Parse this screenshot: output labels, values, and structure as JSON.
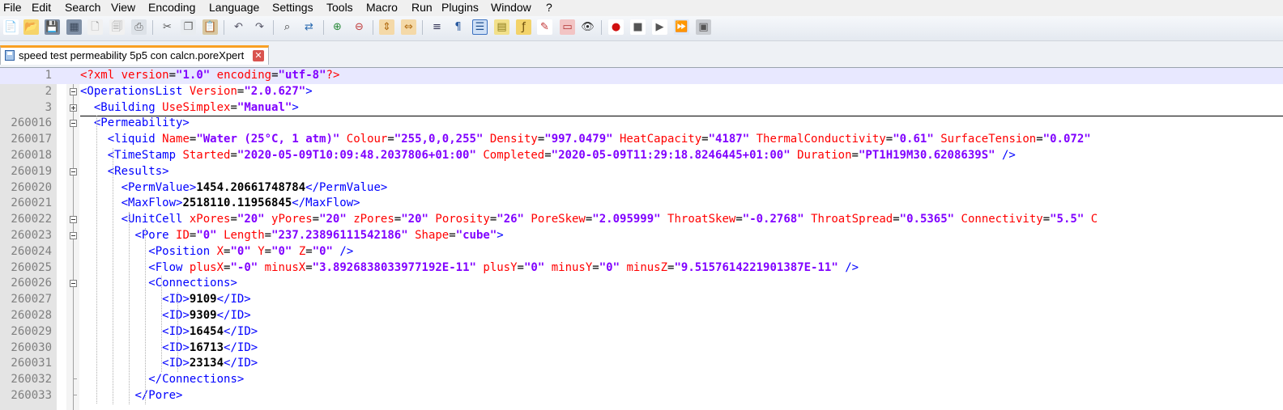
{
  "menu": [
    "File",
    "Edit",
    "Search",
    "View",
    "Encoding",
    "Language",
    "Settings",
    "Tools",
    "Macro",
    "Run",
    "Plugins",
    "Window",
    "?"
  ],
  "toolbar": {
    "icons": [
      "new-file-icon",
      "open-file-icon",
      "save-icon",
      "save-all-icon",
      "close-icon",
      "close-all-icon",
      "print-icon",
      "cut-icon",
      "copy-icon",
      "paste-icon",
      "undo-icon",
      "redo-icon",
      "find-icon",
      "replace-icon",
      "zoom-in-icon",
      "zoom-out-icon",
      "sync-vertical-icon",
      "sync-horizontal-icon",
      "word-wrap-icon",
      "show-all-characters-icon",
      "indent-guide-icon",
      "document-map-icon",
      "function-list-icon",
      "udl-icon",
      "folder-workspace-icon",
      "monitoring-icon",
      "record-macro-icon",
      "stop-recording-icon",
      "playback-icon",
      "run-macro-multiple-icon",
      "save-macro-icon"
    ]
  },
  "tab": {
    "label": "speed test permeability 5p5 con calcn.poreXpert"
  },
  "colors": {
    "tag": "#0000ff",
    "attribute": "#ff0000",
    "value": "#8000ff",
    "current_line": "#e8e8ff",
    "tab_accent": "#f9a023"
  },
  "lines": [
    {
      "num": "1",
      "tokens": [
        [
          "p",
          "<?"
        ],
        [
          "p",
          "xml"
        ],
        [
          "e",
          " "
        ],
        [
          "a",
          "version"
        ],
        [
          "e",
          "="
        ],
        [
          "v",
          "\"1.0\""
        ],
        [
          "e",
          " "
        ],
        [
          "a",
          "encoding"
        ],
        [
          "e",
          "="
        ],
        [
          "v",
          "\"utf-8\""
        ],
        [
          "p",
          "?>"
        ]
      ]
    },
    {
      "num": "2",
      "tokens": [
        [
          "t",
          "<OperationsList"
        ],
        [
          "e",
          " "
        ],
        [
          "a",
          "Version"
        ],
        [
          "e",
          "="
        ],
        [
          "v",
          "\"2.0.627\""
        ],
        [
          "t",
          ">"
        ]
      ]
    },
    {
      "num": "3",
      "tokens": [
        [
          "e",
          "  "
        ],
        [
          "t",
          "<Building"
        ],
        [
          "e",
          " "
        ],
        [
          "a",
          "UseSimplex"
        ],
        [
          "e",
          "="
        ],
        [
          "v",
          "\"Manual\""
        ],
        [
          "t",
          ">"
        ]
      ]
    },
    {
      "num": "260016",
      "tokens": [
        [
          "e",
          "  "
        ],
        [
          "t",
          "<Permeability>"
        ]
      ]
    },
    {
      "num": "260017",
      "tokens": [
        [
          "e",
          "    "
        ],
        [
          "t",
          "<liquid"
        ],
        [
          "e",
          " "
        ],
        [
          "a",
          "Name"
        ],
        [
          "e",
          "="
        ],
        [
          "v",
          "\"Water (25°C, 1 atm)\""
        ],
        [
          "e",
          " "
        ],
        [
          "a",
          "Colour"
        ],
        [
          "e",
          "="
        ],
        [
          "v",
          "\"255,0,0,255\""
        ],
        [
          "e",
          " "
        ],
        [
          "a",
          "Density"
        ],
        [
          "e",
          "="
        ],
        [
          "v",
          "\"997.0479\""
        ],
        [
          "e",
          " "
        ],
        [
          "a",
          "HeatCapacity"
        ],
        [
          "e",
          "="
        ],
        [
          "v",
          "\"4187\""
        ],
        [
          "e",
          " "
        ],
        [
          "a",
          "ThermalConductivity"
        ],
        [
          "e",
          "="
        ],
        [
          "v",
          "\"0.61\""
        ],
        [
          "e",
          " "
        ],
        [
          "a",
          "SurfaceTension"
        ],
        [
          "e",
          "="
        ],
        [
          "v",
          "\"0.072\""
        ]
      ]
    },
    {
      "num": "260018",
      "tokens": [
        [
          "e",
          "    "
        ],
        [
          "t",
          "<TimeStamp"
        ],
        [
          "e",
          " "
        ],
        [
          "a",
          "Started"
        ],
        [
          "e",
          "="
        ],
        [
          "v",
          "\"2020-05-09T10:09:48.2037806+01:00\""
        ],
        [
          "e",
          " "
        ],
        [
          "a",
          "Completed"
        ],
        [
          "e",
          "="
        ],
        [
          "v",
          "\"2020-05-09T11:29:18.8246445+01:00\""
        ],
        [
          "e",
          " "
        ],
        [
          "a",
          "Duration"
        ],
        [
          "e",
          "="
        ],
        [
          "v",
          "\"PT1H19M30.6208639S\""
        ],
        [
          "e",
          " "
        ],
        [
          "t",
          "/>"
        ]
      ]
    },
    {
      "num": "260019",
      "tokens": [
        [
          "e",
          "    "
        ],
        [
          "t",
          "<Results>"
        ]
      ]
    },
    {
      "num": "260020",
      "tokens": [
        [
          "e",
          "      "
        ],
        [
          "t",
          "<PermValue>"
        ],
        [
          "x",
          "1454.20661748784"
        ],
        [
          "t",
          "</PermValue>"
        ]
      ]
    },
    {
      "num": "260021",
      "tokens": [
        [
          "e",
          "      "
        ],
        [
          "t",
          "<MaxFlow>"
        ],
        [
          "x",
          "2518110.11956845"
        ],
        [
          "t",
          "</MaxFlow>"
        ]
      ]
    },
    {
      "num": "260022",
      "tokens": [
        [
          "e",
          "      "
        ],
        [
          "t",
          "<UnitCell"
        ],
        [
          "e",
          " "
        ],
        [
          "a",
          "xPores"
        ],
        [
          "e",
          "="
        ],
        [
          "v",
          "\"20\""
        ],
        [
          "e",
          " "
        ],
        [
          "a",
          "yPores"
        ],
        [
          "e",
          "="
        ],
        [
          "v",
          "\"20\""
        ],
        [
          "e",
          " "
        ],
        [
          "a",
          "zPores"
        ],
        [
          "e",
          "="
        ],
        [
          "v",
          "\"20\""
        ],
        [
          "e",
          " "
        ],
        [
          "a",
          "Porosity"
        ],
        [
          "e",
          "="
        ],
        [
          "v",
          "\"26\""
        ],
        [
          "e",
          " "
        ],
        [
          "a",
          "PoreSkew"
        ],
        [
          "e",
          "="
        ],
        [
          "v",
          "\"2.095999\""
        ],
        [
          "e",
          " "
        ],
        [
          "a",
          "ThroatSkew"
        ],
        [
          "e",
          "="
        ],
        [
          "v",
          "\"-0.2768\""
        ],
        [
          "e",
          " "
        ],
        [
          "a",
          "ThroatSpread"
        ],
        [
          "e",
          "="
        ],
        [
          "v",
          "\"0.5365\""
        ],
        [
          "e",
          " "
        ],
        [
          "a",
          "Connectivity"
        ],
        [
          "e",
          "="
        ],
        [
          "v",
          "\"5.5\""
        ],
        [
          "e",
          " "
        ],
        [
          "a",
          "C"
        ]
      ]
    },
    {
      "num": "260023",
      "tokens": [
        [
          "e",
          "        "
        ],
        [
          "t",
          "<Pore"
        ],
        [
          "e",
          " "
        ],
        [
          "a",
          "ID"
        ],
        [
          "e",
          "="
        ],
        [
          "v",
          "\"0\""
        ],
        [
          "e",
          " "
        ],
        [
          "a",
          "Length"
        ],
        [
          "e",
          "="
        ],
        [
          "v",
          "\"237.23896111542186\""
        ],
        [
          "e",
          " "
        ],
        [
          "a",
          "Shape"
        ],
        [
          "e",
          "="
        ],
        [
          "v",
          "\"cube\""
        ],
        [
          "t",
          ">"
        ]
      ]
    },
    {
      "num": "260024",
      "tokens": [
        [
          "e",
          "          "
        ],
        [
          "t",
          "<Position"
        ],
        [
          "e",
          " "
        ],
        [
          "a",
          "X"
        ],
        [
          "e",
          "="
        ],
        [
          "v",
          "\"0\""
        ],
        [
          "e",
          " "
        ],
        [
          "a",
          "Y"
        ],
        [
          "e",
          "="
        ],
        [
          "v",
          "\"0\""
        ],
        [
          "e",
          " "
        ],
        [
          "a",
          "Z"
        ],
        [
          "e",
          "="
        ],
        [
          "v",
          "\"0\""
        ],
        [
          "e",
          " "
        ],
        [
          "t",
          "/>"
        ]
      ]
    },
    {
      "num": "260025",
      "tokens": [
        [
          "e",
          "          "
        ],
        [
          "t",
          "<Flow"
        ],
        [
          "e",
          " "
        ],
        [
          "a",
          "plusX"
        ],
        [
          "e",
          "="
        ],
        [
          "v",
          "\"-0\""
        ],
        [
          "e",
          " "
        ],
        [
          "a",
          "minusX"
        ],
        [
          "e",
          "="
        ],
        [
          "v",
          "\"3.8926838033977192E-11\""
        ],
        [
          "e",
          " "
        ],
        [
          "a",
          "plusY"
        ],
        [
          "e",
          "="
        ],
        [
          "v",
          "\"0\""
        ],
        [
          "e",
          " "
        ],
        [
          "a",
          "minusY"
        ],
        [
          "e",
          "="
        ],
        [
          "v",
          "\"0\""
        ],
        [
          "e",
          " "
        ],
        [
          "a",
          "minusZ"
        ],
        [
          "e",
          "="
        ],
        [
          "v",
          "\"9.5157614221901387E-11\""
        ],
        [
          "e",
          " "
        ],
        [
          "t",
          "/>"
        ]
      ]
    },
    {
      "num": "260026",
      "tokens": [
        [
          "e",
          "          "
        ],
        [
          "t",
          "<Connections>"
        ]
      ]
    },
    {
      "num": "260027",
      "tokens": [
        [
          "e",
          "            "
        ],
        [
          "t",
          "<ID>"
        ],
        [
          "x",
          "9109"
        ],
        [
          "t",
          "</ID>"
        ]
      ]
    },
    {
      "num": "260028",
      "tokens": [
        [
          "e",
          "            "
        ],
        [
          "t",
          "<ID>"
        ],
        [
          "x",
          "9309"
        ],
        [
          "t",
          "</ID>"
        ]
      ]
    },
    {
      "num": "260029",
      "tokens": [
        [
          "e",
          "            "
        ],
        [
          "t",
          "<ID>"
        ],
        [
          "x",
          "16454"
        ],
        [
          "t",
          "</ID>"
        ]
      ]
    },
    {
      "num": "260030",
      "tokens": [
        [
          "e",
          "            "
        ],
        [
          "t",
          "<ID>"
        ],
        [
          "x",
          "16713"
        ],
        [
          "t",
          "</ID>"
        ]
      ]
    },
    {
      "num": "260031",
      "tokens": [
        [
          "e",
          "            "
        ],
        [
          "t",
          "<ID>"
        ],
        [
          "x",
          "23134"
        ],
        [
          "t",
          "</ID>"
        ]
      ]
    },
    {
      "num": "260032",
      "tokens": [
        [
          "e",
          "          "
        ],
        [
          "t",
          "</Connections>"
        ]
      ]
    },
    {
      "num": "260033",
      "tokens": [
        [
          "e",
          "        "
        ],
        [
          "t",
          "</Pore>"
        ]
      ]
    }
  ]
}
